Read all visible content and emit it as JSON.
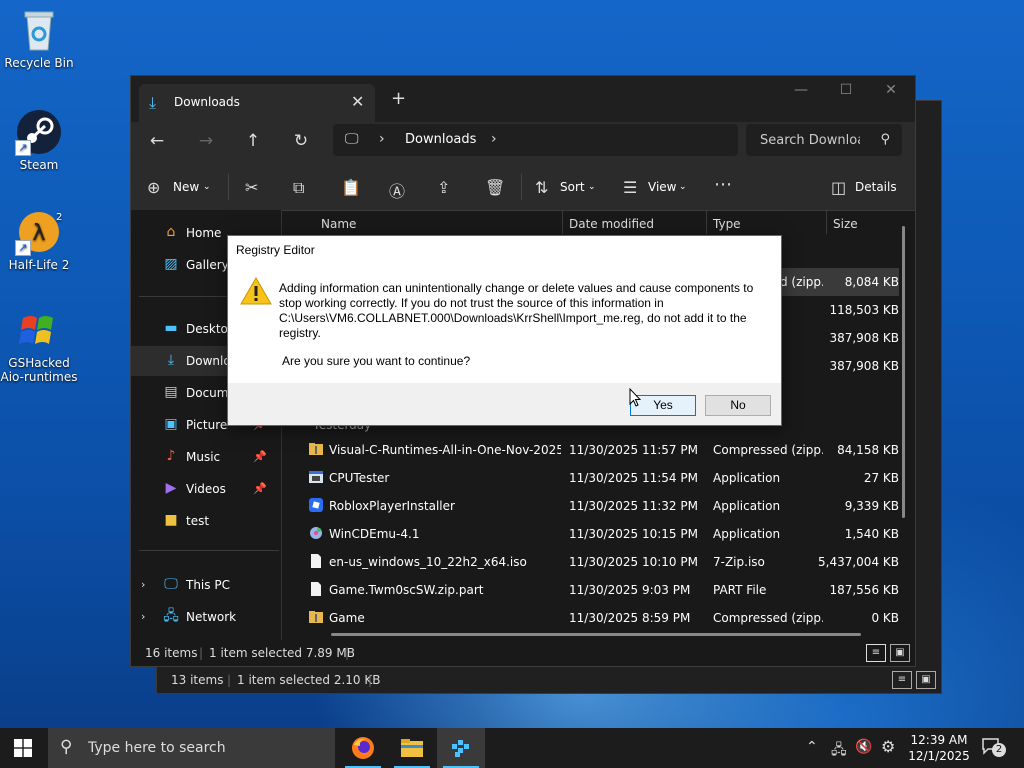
{
  "desktop": {
    "icons": [
      {
        "label": "Recycle Bin"
      },
      {
        "label": "Steam"
      },
      {
        "label": "Half-Life 2"
      },
      {
        "label": "GSHacked Aio-runtimes"
      }
    ]
  },
  "back_window": {
    "status": {
      "items": "13 items",
      "selected": "1 item selected  2.10 KB"
    }
  },
  "explorer": {
    "tab_title": "Downloads",
    "breadcrumb": "Downloads",
    "search_placeholder": "Search Downloads",
    "commands": {
      "new": "New",
      "sort": "Sort",
      "view": "View",
      "details": "Details"
    },
    "sidebar": {
      "home": "Home",
      "gallery": "Gallery",
      "desktop": "Desktop",
      "downloads": "Downloads",
      "documents": "Documents",
      "pictures": "Pictures",
      "music": "Music",
      "videos": "Videos",
      "test": "test",
      "this_pc": "This PC",
      "network": "Network"
    },
    "columns": {
      "name": "Name",
      "date": "Date modified",
      "type": "Type",
      "size": "Size"
    },
    "group_label": "Yesterday",
    "top_rows": [
      {
        "type": "Compressed (zipp...",
        "size": "8,084 KB"
      },
      {
        "type": "",
        "size": "118,503 KB"
      },
      {
        "type": "",
        "size": "387,908 KB"
      },
      {
        "type": "",
        "size": "387,908 KB"
      }
    ],
    "rows": [
      {
        "name": "Visual-C-Runtimes-All-in-One-Nov-2025",
        "date": "11/30/2025 11:57 PM",
        "type": "Compressed (zipp...",
        "size": "84,158 KB"
      },
      {
        "name": "CPUTester",
        "date": "11/30/2025 11:54 PM",
        "type": "Application",
        "size": "27 KB"
      },
      {
        "name": "RobloxPlayerInstaller",
        "date": "11/30/2025 11:32 PM",
        "type": "Application",
        "size": "9,339 KB"
      },
      {
        "name": "WinCDEmu-4.1",
        "date": "11/30/2025 10:15 PM",
        "type": "Application",
        "size": "1,540 KB"
      },
      {
        "name": "en-us_windows_10_22h2_x64.iso",
        "date": "11/30/2025 10:10 PM",
        "type": "7-Zip.iso",
        "size": "5,437,004 KB"
      },
      {
        "name": "Game.Twm0scSW.zip.part",
        "date": "11/30/2025 9:03 PM",
        "type": "PART File",
        "size": "187,556 KB"
      },
      {
        "name": "Game",
        "date": "11/30/2025 8:59 PM",
        "type": "Compressed (zipp...",
        "size": "0 KB"
      }
    ],
    "status": {
      "items": "16 items",
      "selected": "1 item selected  7.89 MB"
    }
  },
  "dialog": {
    "title": "Registry Editor",
    "message_lines": [
      "Adding information can unintentionally change or delete values and cause components to",
      "stop working correctly. If you do not trust the source of this information in",
      "C:\\Users\\VM6.COLLABNET.000\\Downloads\\KrrShell\\Import_me.reg, do not add it to the",
      "registry."
    ],
    "question": "Are you sure you want to continue?",
    "yes": "Yes",
    "no": "No"
  },
  "taskbar": {
    "search_placeholder": "Type here to search",
    "time": "12:39 AM",
    "date": "12/1/2025",
    "notification_count": "2"
  }
}
